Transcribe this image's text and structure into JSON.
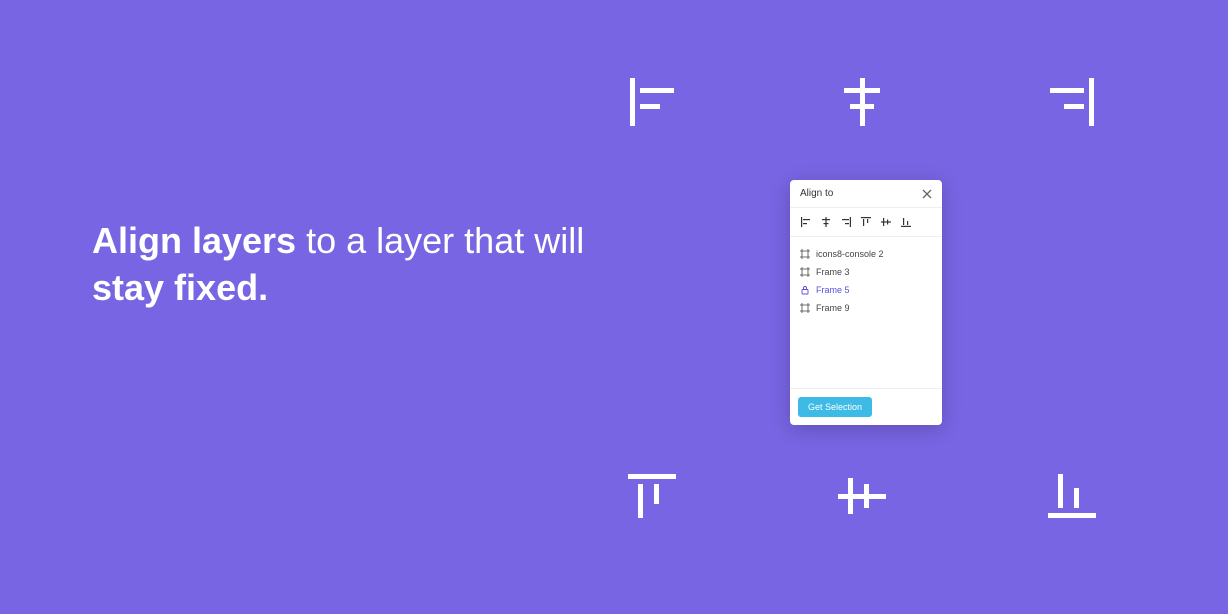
{
  "headline": {
    "part1": "Align layers",
    "part2": " to a layer that will ",
    "part3": "stay fixed."
  },
  "panel": {
    "title": "Align to",
    "layers": [
      {
        "name": "icons8-console 2",
        "selected": false,
        "locked": false
      },
      {
        "name": "Frame 3",
        "selected": false,
        "locked": false
      },
      {
        "name": "Frame 5",
        "selected": true,
        "locked": true
      },
      {
        "name": "Frame 9",
        "selected": false,
        "locked": false
      }
    ],
    "button": "Get Selection"
  },
  "toolbar_icons": [
    "align-left",
    "align-horizontal-center",
    "align-right",
    "align-top",
    "align-vertical-center",
    "align-bottom"
  ],
  "bg_icons": [
    "align-left-large",
    "align-horizontal-center-large",
    "align-right-large",
    "align-top-large",
    "align-vertical-center-large",
    "align-bottom-large"
  ]
}
